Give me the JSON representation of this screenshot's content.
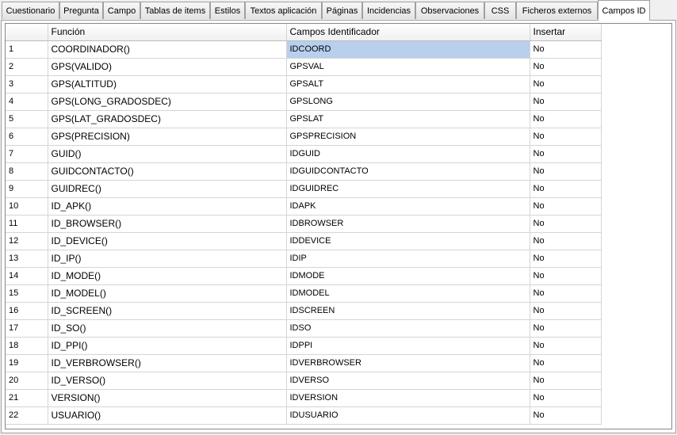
{
  "tabs": [
    {
      "label": "Cuestionario",
      "active": false
    },
    {
      "label": "Pregunta",
      "active": false
    },
    {
      "label": "Campo",
      "active": false
    },
    {
      "label": "Tablas de items",
      "active": false
    },
    {
      "label": "Estilos",
      "active": false
    },
    {
      "label": "Textos aplicación",
      "active": false
    },
    {
      "label": "Páginas",
      "active": false
    },
    {
      "label": "Incidencias",
      "active": false
    },
    {
      "label": "Observaciones",
      "active": false
    },
    {
      "label": "CSS",
      "active": false
    },
    {
      "label": "Ficheros externos",
      "active": false
    },
    {
      "label": "Campos ID",
      "active": true
    }
  ],
  "table": {
    "headers": [
      "",
      "Función",
      "Campos Identificador",
      "Insertar"
    ],
    "selected_cell": {
      "row": 0,
      "column": "Campos Identificador"
    },
    "rows": [
      {
        "n": "1",
        "fn": "COORDINADOR()",
        "id": "IDCOORD",
        "ins": "No"
      },
      {
        "n": "2",
        "fn": "GPS(VALIDO)",
        "id": "GPSVAL",
        "ins": "No"
      },
      {
        "n": "3",
        "fn": "GPS(ALTITUD)",
        "id": "GPSALT",
        "ins": "No"
      },
      {
        "n": "4",
        "fn": "GPS(LONG_GRADOSDEC)",
        "id": "GPSLONG",
        "ins": "No"
      },
      {
        "n": "5",
        "fn": "GPS(LAT_GRADOSDEC)",
        "id": "GPSLAT",
        "ins": "No"
      },
      {
        "n": "6",
        "fn": "GPS(PRECISION)",
        "id": "GPSPRECISION",
        "ins": "No"
      },
      {
        "n": "7",
        "fn": "GUID()",
        "id": "IDGUID",
        "ins": "No"
      },
      {
        "n": "8",
        "fn": "GUIDCONTACTO()",
        "id": "IDGUIDCONTACTO",
        "ins": "No"
      },
      {
        "n": "9",
        "fn": "GUIDREC()",
        "id": "IDGUIDREC",
        "ins": "No"
      },
      {
        "n": "10",
        "fn": "ID_APK()",
        "id": "IDAPK",
        "ins": "No"
      },
      {
        "n": "11",
        "fn": "ID_BROWSER()",
        "id": "IDBROWSER",
        "ins": "No"
      },
      {
        "n": "12",
        "fn": "ID_DEVICE()",
        "id": "IDDEVICE",
        "ins": "No"
      },
      {
        "n": "13",
        "fn": "ID_IP()",
        "id": "IDIP",
        "ins": "No"
      },
      {
        "n": "14",
        "fn": "ID_MODE()",
        "id": "IDMODE",
        "ins": "No"
      },
      {
        "n": "15",
        "fn": "ID_MODEL()",
        "id": "IDMODEL",
        "ins": "No"
      },
      {
        "n": "16",
        "fn": "ID_SCREEN()",
        "id": "IDSCREEN",
        "ins": "No"
      },
      {
        "n": "17",
        "fn": "ID_SO()",
        "id": "IDSO",
        "ins": "No"
      },
      {
        "n": "18",
        "fn": "ID_PPI()",
        "id": "IDPPI",
        "ins": "No"
      },
      {
        "n": "19",
        "fn": "ID_VERBROWSER()",
        "id": "IDVERBROWSER",
        "ins": "No"
      },
      {
        "n": "20",
        "fn": "ID_VERSO()",
        "id": "IDVERSO",
        "ins": "No"
      },
      {
        "n": "21",
        "fn": "VERSION()",
        "id": "IDVERSION",
        "ins": "No"
      },
      {
        "n": "22",
        "fn": "USUARIO()",
        "id": "IDUSUARIO",
        "ins": "No"
      }
    ]
  },
  "colors": {
    "selection": "#b8cfee",
    "grid_line": "#d5d5d5"
  }
}
